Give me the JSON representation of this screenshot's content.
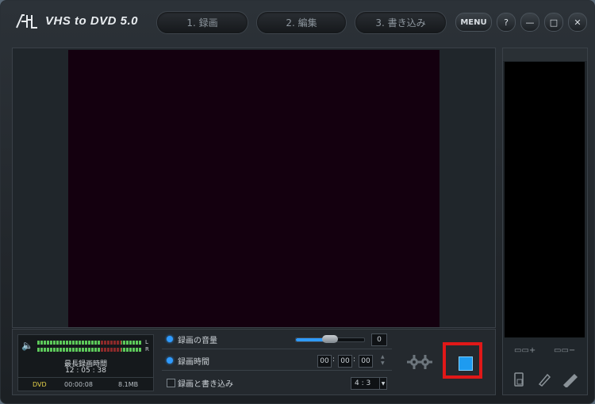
{
  "app": {
    "title": "VHS to DVD 5.0"
  },
  "tabs": [
    {
      "label": "1. 録画"
    },
    {
      "label": "2. 編集"
    },
    {
      "label": "3. 書き込み"
    }
  ],
  "window_buttons": {
    "menu": "MENU",
    "help": "?",
    "minimize": "—",
    "maximize": "□",
    "close": "✕"
  },
  "meter": {
    "left": "L",
    "right": "R",
    "max_label": "最長録画時間",
    "max_time": "12 : 05 : 38",
    "format": "DVD",
    "elapsed": "00:00:08",
    "size": "8.1MB"
  },
  "settings": {
    "volume_label": "録画の音量",
    "volume_value": "0",
    "volume_level": 0.5,
    "duration_label": "録画時間",
    "hours": "00",
    "minutes": "00",
    "seconds": "00",
    "record_write_label": "録画と書き込み",
    "record_write_checked": false,
    "aspect": "4 : 3"
  },
  "side": {
    "add": "▭▭+",
    "remove": "▭▭−"
  },
  "colors": {
    "accent": "#2f9bff",
    "record_frame": "#e01818",
    "preview_bg": "#14000f"
  }
}
